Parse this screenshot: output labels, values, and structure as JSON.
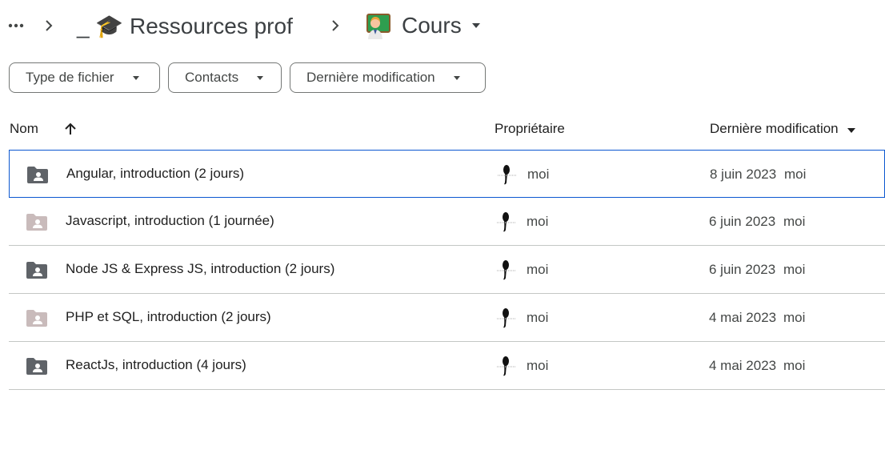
{
  "breadcrumb": {
    "more_icon": "more-horiz-icon",
    "segments": [
      {
        "label": "_ 🎓 Ressources prof",
        "icon": "graduation-cap-icon"
      },
      {
        "label": "Cours",
        "icon": "teacher-emoji-icon"
      }
    ],
    "separator_icon": "chevron-right-icon"
  },
  "filters": [
    {
      "label": "Type de fichier"
    },
    {
      "label": "Contacts"
    },
    {
      "label": "Dernière modification"
    }
  ],
  "table": {
    "columns": {
      "name": "Nom",
      "owner": "Propriétaire",
      "modified": "Dernière modification"
    },
    "rows": [
      {
        "name": "Angular, introduction (2 jours)",
        "owner": "moi",
        "date": "8 juin 2023",
        "modifier": "moi",
        "folder_color": "#5f6368",
        "selected": true
      },
      {
        "name": "Javascript, introduction (1 journée)",
        "owner": "moi",
        "date": "6 juin 2023",
        "modifier": "moi",
        "folder_color": "#c9bbbb",
        "selected": false
      },
      {
        "name": "Node JS & Express JS, introduction (2 jours)",
        "owner": "moi",
        "date": "6 juin 2023",
        "modifier": "moi",
        "folder_color": "#5f6368",
        "selected": false
      },
      {
        "name": "PHP et SQL, introduction (2 jours)",
        "owner": "moi",
        "date": "4 mai 2023",
        "modifier": "moi",
        "folder_color": "#c9bbbb",
        "selected": false
      },
      {
        "name": "ReactJs, introduction (4 jours)",
        "owner": "moi",
        "date": "4 mai 2023",
        "modifier": "moi",
        "folder_color": "#5f6368",
        "selected": false
      }
    ]
  },
  "colors": {
    "accent": "#0b57d0",
    "divider": "#c4c7c5"
  }
}
